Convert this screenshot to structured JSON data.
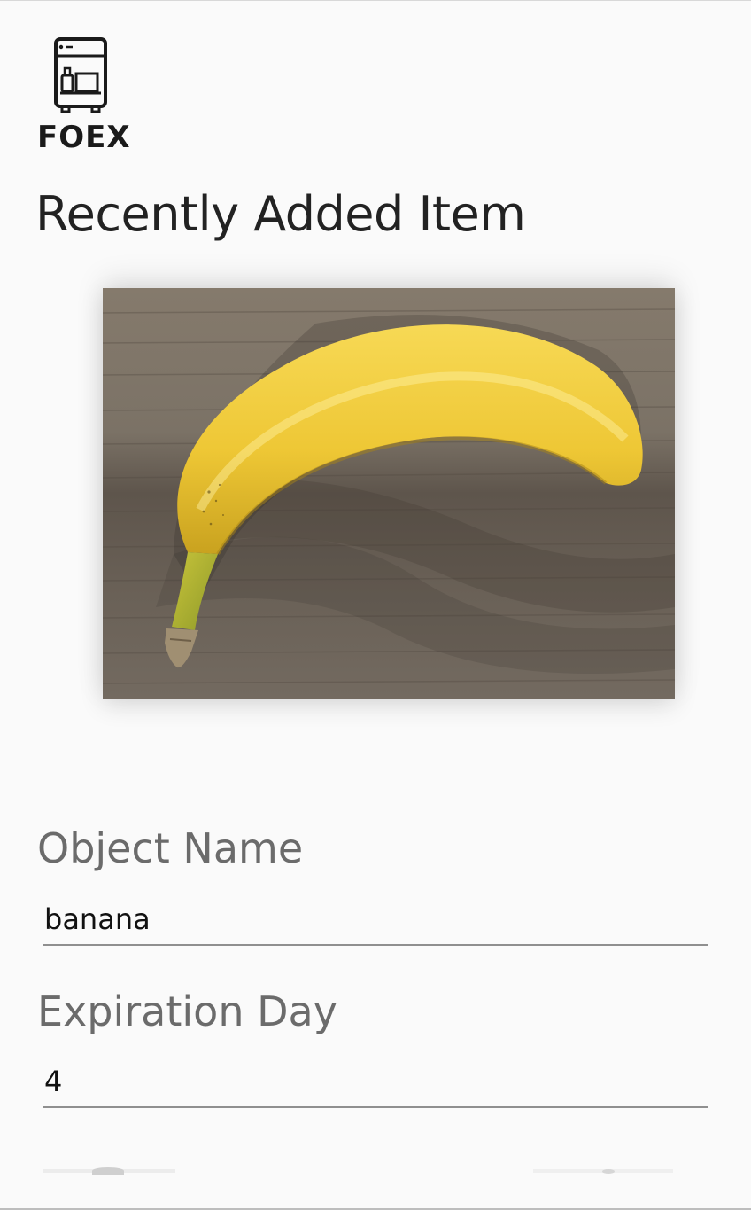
{
  "app": {
    "logo_icon": "fridge-icon",
    "logo_text": "FOEX"
  },
  "page": {
    "title": "Recently Added Item"
  },
  "item_photo": {
    "alt": "banana",
    "description_icon": "banana-photo"
  },
  "form": {
    "object_name": {
      "label": "Object Name",
      "value": "banana"
    },
    "expiration_day": {
      "label": "Expiration Day",
      "value": "4"
    }
  },
  "colors": {
    "background": "#fafafa",
    "label_gray": "#6b6b6b",
    "underline_gray": "#8f8f8f",
    "banana_yellow": "#f2cf3c",
    "wood_brown": "#6e655a"
  }
}
